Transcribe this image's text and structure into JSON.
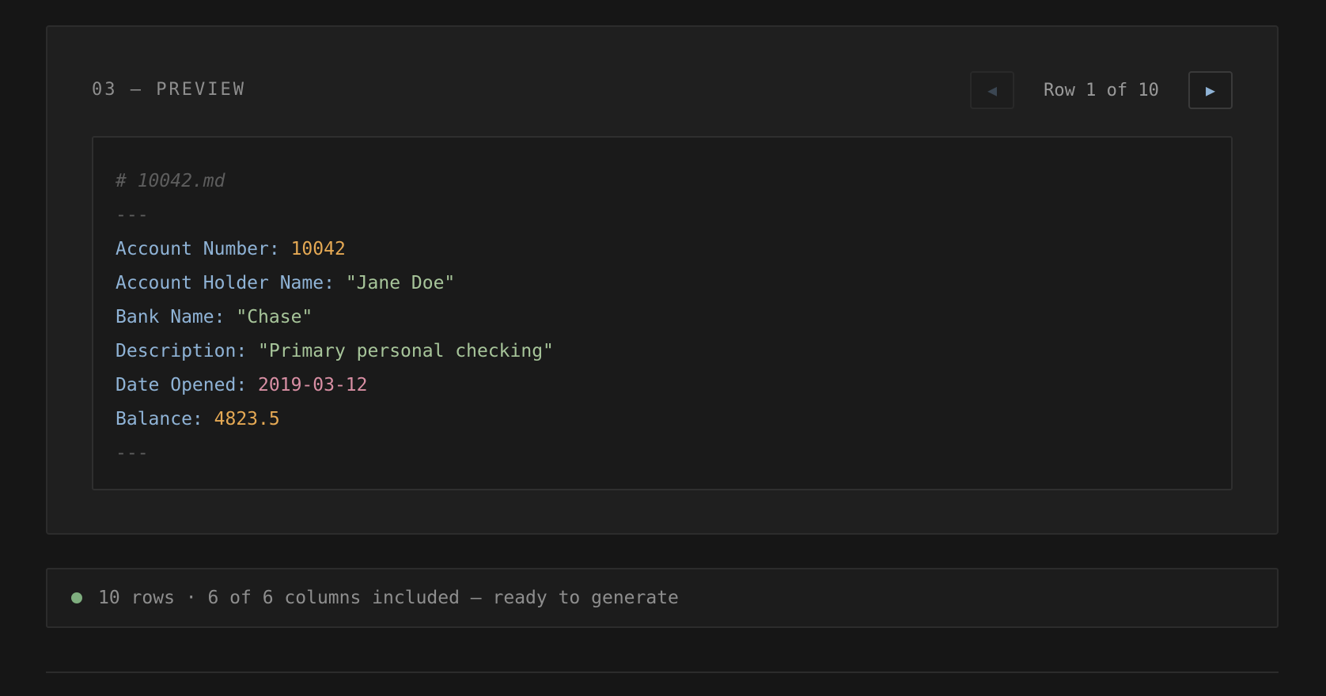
{
  "preview": {
    "section_title": "03 — PREVIEW",
    "pager": {
      "prev_icon": "◀",
      "next_icon": "▶",
      "label": "Row 1 of 10"
    },
    "code": {
      "comment": "# 10042.md",
      "rule_open": "---",
      "fields": [
        {
          "key": "Account Number:",
          "value": "10042",
          "type": "number"
        },
        {
          "key": "Account Holder Name:",
          "value": "\"Jane Doe\"",
          "type": "string"
        },
        {
          "key": "Bank Name:",
          "value": "\"Chase\"",
          "type": "string"
        },
        {
          "key": "Description:",
          "value": "\"Primary personal checking\"",
          "type": "string"
        },
        {
          "key": "Date Opened:",
          "value": "2019-03-12",
          "type": "date"
        },
        {
          "key": "Balance:",
          "value": "4823.5",
          "type": "number"
        }
      ],
      "rule_close": "---"
    }
  },
  "status": {
    "text": "10 rows · 6 of 6 columns included — ready to generate",
    "dot_color": "#7fae7f"
  },
  "colors": {
    "key": "#8fb3d6",
    "number": "#e5a954",
    "string": "#a7c59a",
    "date": "#d98fa4",
    "comment": "#5d5d5d"
  }
}
